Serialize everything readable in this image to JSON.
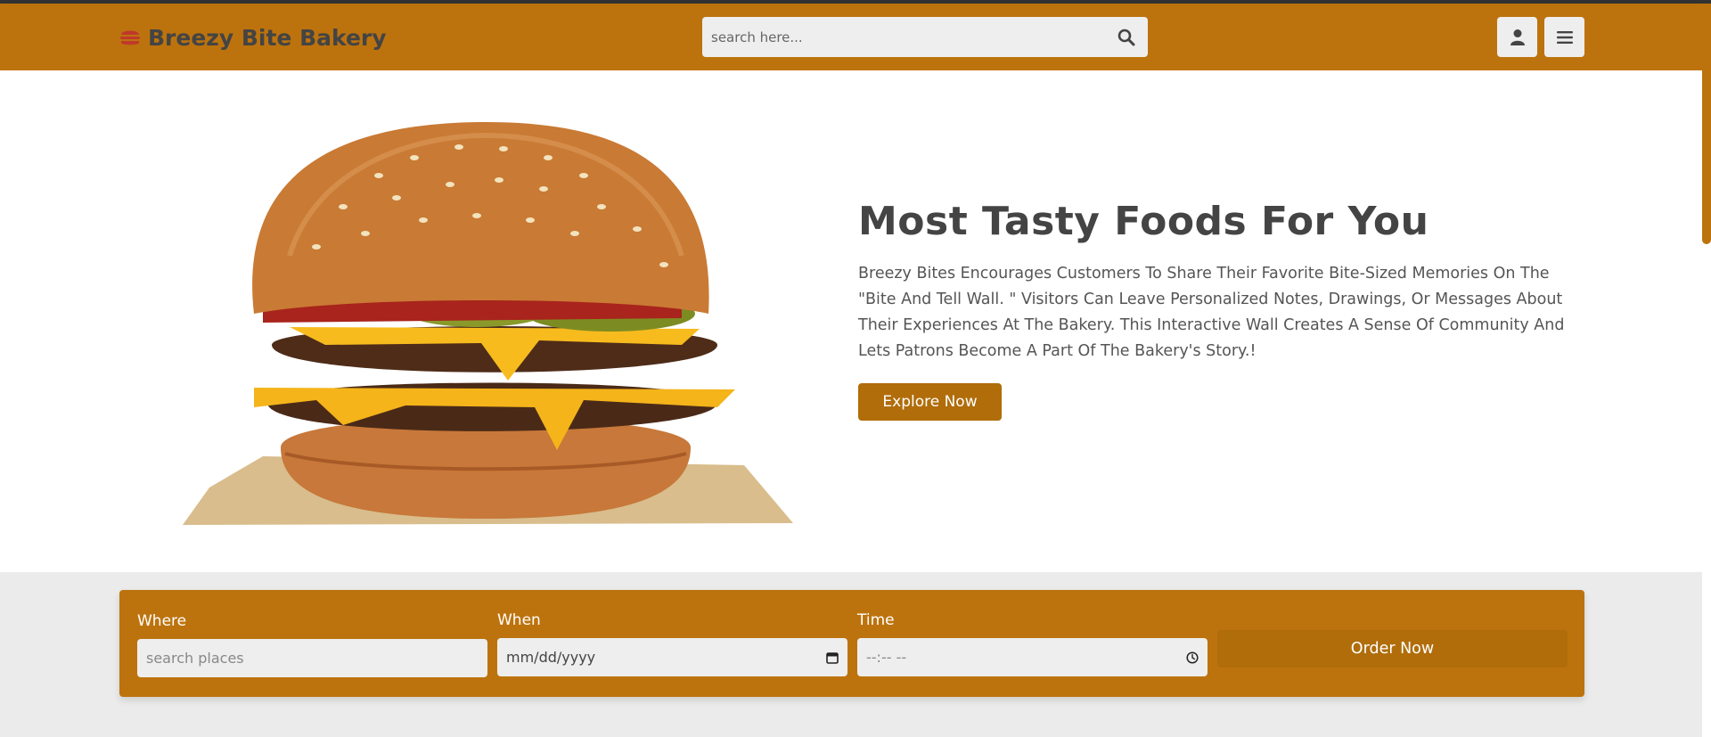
{
  "header": {
    "logo_text": "Breezy Bite Bakery",
    "logo_icon": "hamburger-icon",
    "search_placeholder": "search here...",
    "search_icon": "search-icon",
    "user_icon": "user-icon",
    "menu_icon": "menu-icon"
  },
  "hero": {
    "title": "Most Tasty Foods For You",
    "description": "Breezy Bites Encourages Customers To Share Their Favorite Bite-Sized Memories On The \"Bite And Tell Wall. \" Visitors Can Leave Personalized Notes, Drawings, Or Messages About Their Experiences At The Bakery. This Interactive Wall Creates A Sense Of Community And Lets Patrons Become A Part Of The Bakery's Story.!",
    "button_label": "Explore Now",
    "image": "burger-image"
  },
  "order_form": {
    "where_label": "Where",
    "where_placeholder": "search places",
    "when_label": "When",
    "when_placeholder": "mm/dd/yyyy",
    "time_label": "Time",
    "time_placeholder": "--:-- --",
    "button_label": "Order Now"
  },
  "colors": {
    "brand": "#bd730d",
    "button": "#b06d0a",
    "text": "#444444",
    "field": "#eeeeee"
  }
}
